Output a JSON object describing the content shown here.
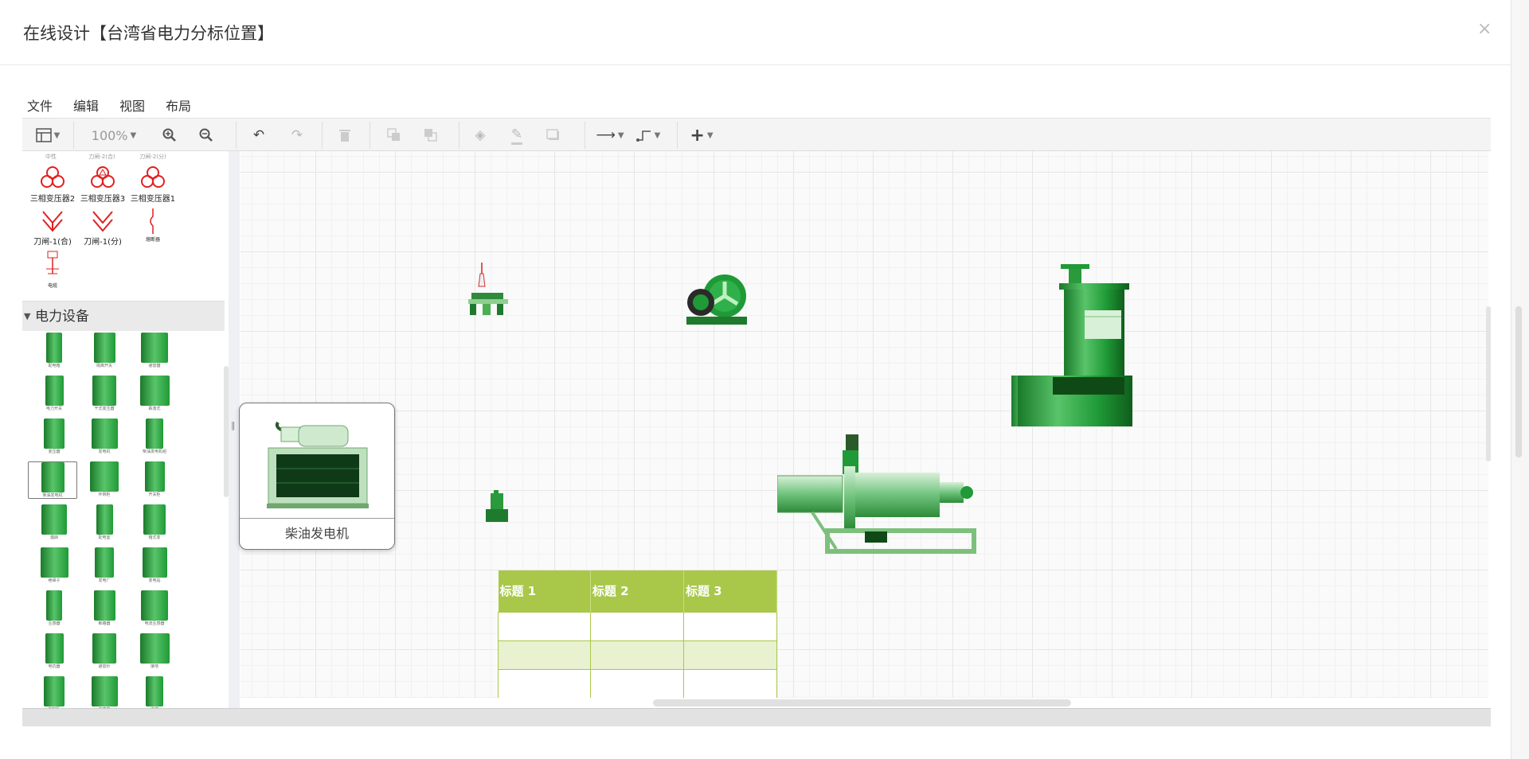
{
  "dialog": {
    "title": "在线设计【台湾省电力分标位置】",
    "close": "×"
  },
  "menu": {
    "file": "文件",
    "edit": "编辑",
    "view": "视图",
    "layout": "布局"
  },
  "toolbar": {
    "zoom": "100%"
  },
  "sidebar": {
    "top_cut_labels": [
      "中性",
      "刀闸-2(合)",
      "刀闸-2(分)"
    ],
    "transformers": [
      "三相变压器2",
      "三相变压器3",
      "三相变压器1"
    ],
    "switches": [
      "刀闸-1(合)",
      "刀闸-1(分)",
      "熔断器"
    ],
    "misc": "电缆",
    "section_title": "电力设备",
    "equipment_labels": [
      "配电箱",
      "隔离开关",
      "避雷器",
      "电力开关",
      "干式变压器",
      "跌落式",
      "变压器",
      "发电机",
      "柴油发电机组",
      "柴油发电机",
      "环网柜",
      "开关柜",
      "烟囱",
      "配电室",
      "箱式变",
      "绝缘子",
      "发电厂",
      "变电站",
      "互感器",
      "断路器",
      "电流互感器",
      "电抗器",
      "避雷针",
      "接地",
      "控制柜",
      "电表箱",
      "终端"
    ]
  },
  "tooltip": {
    "label": "柴油发电机"
  },
  "table": {
    "headers": [
      "标题 1",
      "标题 2",
      "标题 3"
    ]
  },
  "colors": {
    "table_header": "#a9c84a",
    "table_alt_row": "#e8f1d0",
    "equipment_green": "#1f9a36",
    "transformer_red": "#e02020"
  }
}
